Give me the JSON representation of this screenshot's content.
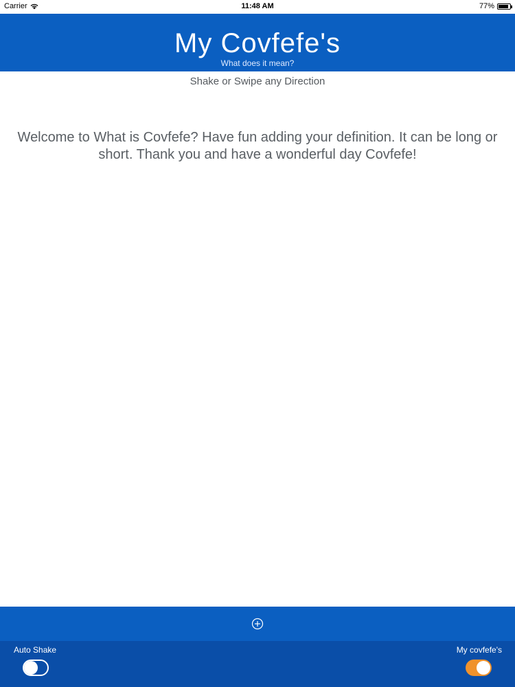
{
  "status_bar": {
    "carrier": "Carrier",
    "time": "11:48 AM",
    "battery": "77%",
    "battery_level": 0.77
  },
  "header": {
    "title": "My Covfefe's",
    "subtitle": "What does it mean?"
  },
  "main": {
    "hint": "Shake or Swipe any Direction",
    "welcome": "Welcome to What is Covfefe?  Have fun adding your definition. It can be long or short.   Thank you and have a wonderful day Covfefe!"
  },
  "toolbar": {
    "add_icon": "plus-circle-icon"
  },
  "bottom": {
    "auto_shake_label": "Auto Shake",
    "auto_shake_on": false,
    "my_covfefes_label": "My covfefe's",
    "my_covfefes_on": true,
    "accent": "#f0922c"
  },
  "colors": {
    "header": "#0b5fc1",
    "footer": "#0a4ea8"
  }
}
